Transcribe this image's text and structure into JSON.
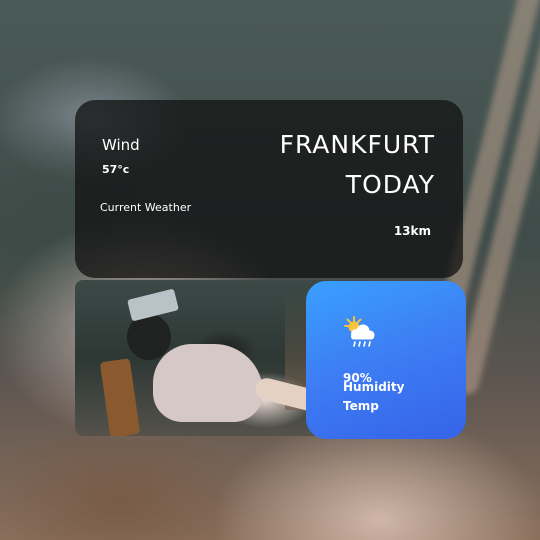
{
  "weather": {
    "wind_label": "Wind",
    "wind_value": "57°c",
    "current_label": "Current Weather",
    "city": "FRANKFURT",
    "day": "TODAY",
    "distance": "13km"
  },
  "stats": {
    "icon": "sun-cloud-rain-icon",
    "humidity_value": "90%",
    "humidity_label": "Humidity",
    "temp_label": "Temp"
  },
  "colors": {
    "card_dark": "#121212",
    "stats_blue_top": "#3aa0ff",
    "stats_blue_bottom": "#3563e8",
    "text": "#ffffff",
    "sun": "#f7c33a"
  }
}
